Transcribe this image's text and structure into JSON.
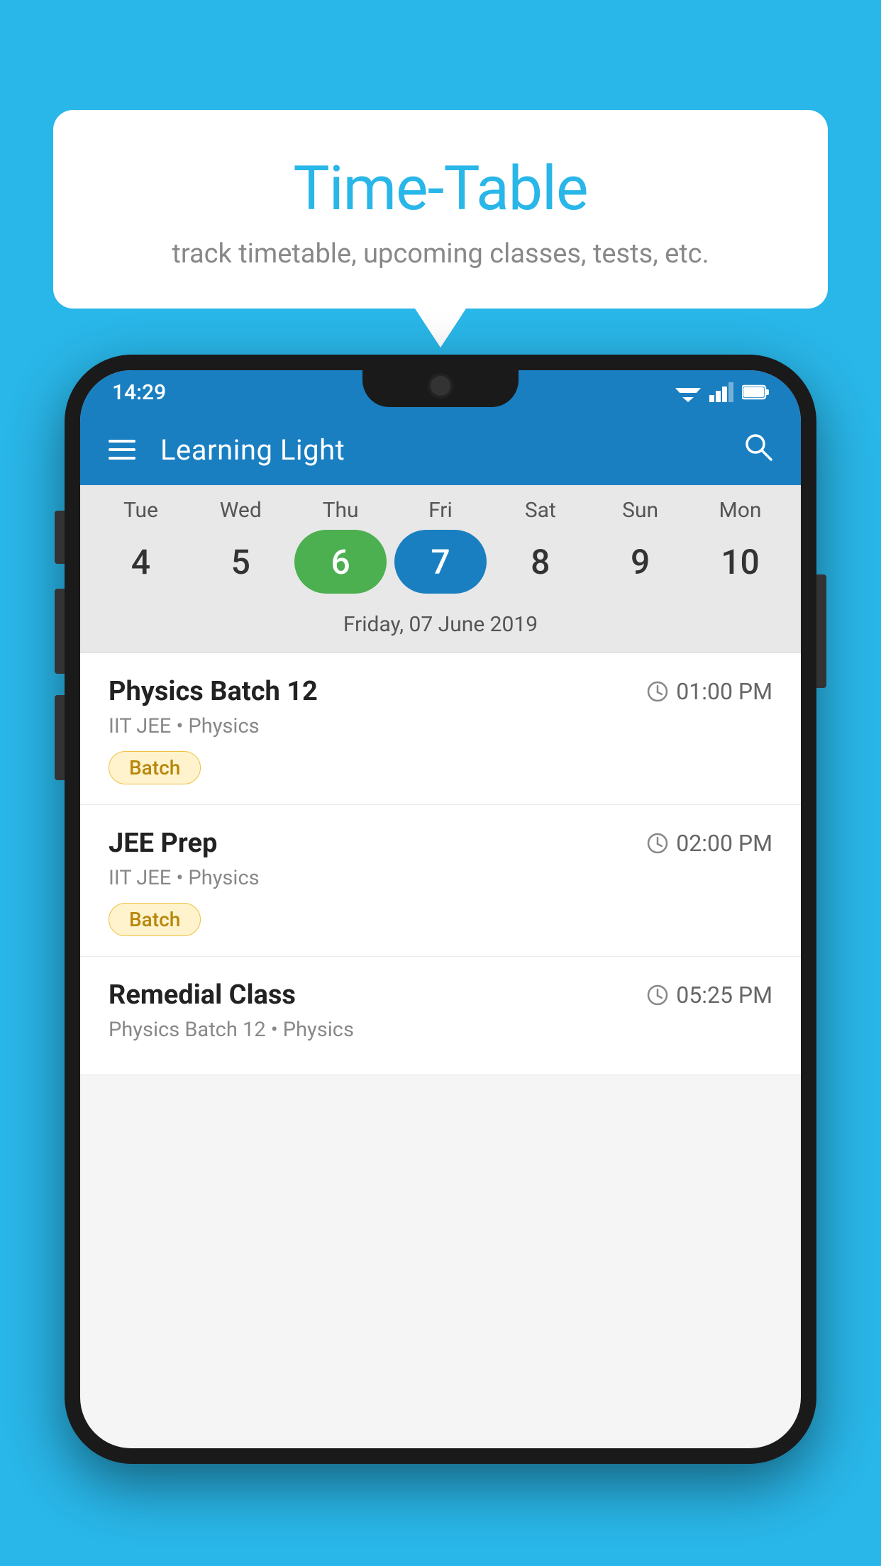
{
  "background_color": "#29b6e8",
  "bubble": {
    "title": "Time-Table",
    "subtitle": "track timetable, upcoming classes, tests, etc."
  },
  "status_bar": {
    "time": "14:29",
    "signal_icon": "▲",
    "wifi_icon": "▼"
  },
  "app_bar": {
    "title": "Learning Light",
    "menu_icon": "menu",
    "search_icon": "search"
  },
  "calendar": {
    "days": [
      {
        "label": "Tue",
        "number": "4",
        "state": "normal"
      },
      {
        "label": "Wed",
        "number": "5",
        "state": "normal"
      },
      {
        "label": "Thu",
        "number": "6",
        "state": "today"
      },
      {
        "label": "Fri",
        "number": "7",
        "state": "selected"
      },
      {
        "label": "Sat",
        "number": "8",
        "state": "normal"
      },
      {
        "label": "Sun",
        "number": "9",
        "state": "normal"
      },
      {
        "label": "Mon",
        "number": "10",
        "state": "normal"
      }
    ],
    "selected_date_label": "Friday, 07 June 2019"
  },
  "schedule": {
    "items": [
      {
        "title": "Physics Batch 12",
        "time": "01:00 PM",
        "subtitle": "IIT JEE • Physics",
        "badge": "Batch"
      },
      {
        "title": "JEE Prep",
        "time": "02:00 PM",
        "subtitle": "IIT JEE • Physics",
        "badge": "Batch"
      },
      {
        "title": "Remedial Class",
        "time": "05:25 PM",
        "subtitle": "Physics Batch 12 • Physics",
        "badge": null
      }
    ]
  }
}
